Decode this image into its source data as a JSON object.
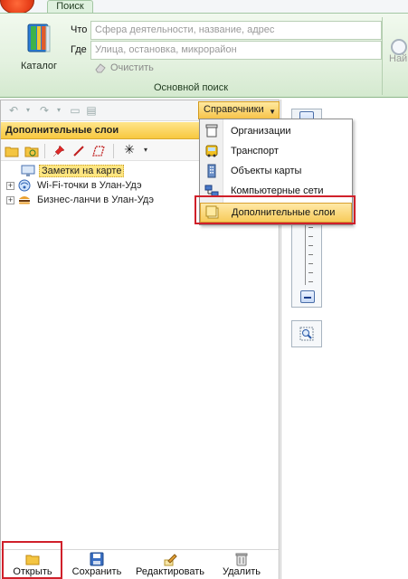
{
  "ribbon": {
    "tab": "Поиск",
    "catalog_label": "Каталог",
    "what_label": "Что",
    "what_placeholder": "Сфера деятельности, название, адрес",
    "where_label": "Где",
    "where_placeholder": "Улица, остановка, микрорайон",
    "clear_label": "Очистить",
    "find_label": "Най",
    "group_label": "Основной поиск"
  },
  "left_panel": {
    "directories_button": "Справочники",
    "header": "Дополнительные слои",
    "tree": [
      {
        "label": "Заметки на карте",
        "selected": true,
        "expandable": false
      },
      {
        "label": "Wi-Fi-точки в Улан-Удэ",
        "selected": false,
        "expandable": true
      },
      {
        "label": "Бизнес-ланчи в Улан-Удэ",
        "selected": false,
        "expandable": true
      }
    ],
    "bottom": {
      "open": "Открыть",
      "save": "Сохранить",
      "edit": "Редактировать",
      "delete": "Удалить"
    }
  },
  "dropdown": {
    "items": [
      {
        "label": "Организации",
        "icon": "organizations-icon"
      },
      {
        "label": "Транспорт",
        "icon": "bus-icon"
      },
      {
        "label": "Объекты карты",
        "icon": "building-icon"
      },
      {
        "label": "Компьютерные сети",
        "icon": "network-icon"
      },
      {
        "label": "Дополнительные слои",
        "icon": "layers-icon",
        "active": true
      }
    ]
  },
  "colors": {
    "accent": "#f7c44a",
    "highlight_frame": "#d0202a",
    "ribbon_green": "#e3f1df"
  }
}
